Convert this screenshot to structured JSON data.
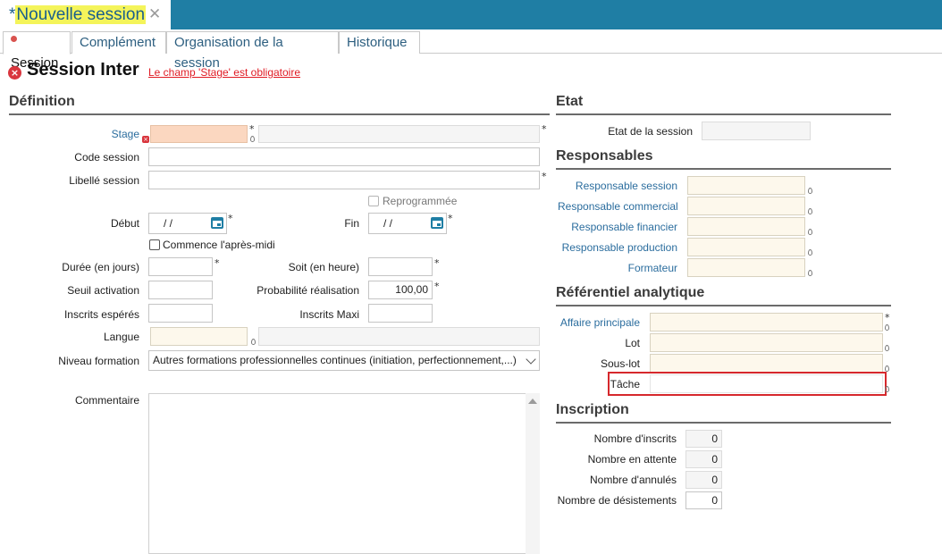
{
  "tab": {
    "modified_marker": "*",
    "title": "Nouvelle session",
    "close_glyph": "✕"
  },
  "subtabs": [
    "Session",
    "Complément",
    "Organisation de la session",
    "Historique"
  ],
  "page": {
    "title": "Session Inter",
    "error_message": "Le champ 'Stage' est obligatoire"
  },
  "definition": {
    "header": "Définition",
    "stage_label": "Stage",
    "code_label": "Code session",
    "libelle_label": "Libellé session",
    "reprogrammee_label": "Reprogrammée",
    "debut_label": "Début",
    "debut_value": "/  /",
    "fin_label": "Fin",
    "fin_value": "/  /",
    "apres_midi_label": "Commence l'après-midi",
    "duree_label": "Durée (en jours)",
    "soit_label": "Soit (en heure)",
    "seuil_label": "Seuil activation",
    "proba_label": "Probabilité réalisation",
    "proba_value": "100,00",
    "inscrits_esperes_label": "Inscrits espérés",
    "inscrits_maxi_label": "Inscrits Maxi",
    "langue_label": "Langue",
    "niveau_label": "Niveau formation",
    "niveau_value": "Autres formations professionnelles continues (initiation, perfectionnement,...)",
    "commentaire_label": "Commentaire",
    "required_mark": "*"
  },
  "etat": {
    "header": "Etat",
    "etat_label": "Etat de la session"
  },
  "responsables": {
    "header": "Responsables",
    "items": [
      "Responsable session",
      "Responsable commercial",
      "Responsable financier",
      "Responsable production",
      "Formateur"
    ]
  },
  "analytique": {
    "header": "Référentiel analytique",
    "affaire_label": "Affaire principale",
    "lot_label": "Lot",
    "souslot_label": "Sous-lot",
    "tache_label": "Tâche"
  },
  "inscription": {
    "header": "Inscription",
    "rows": [
      {
        "label": "Nombre d'inscrits",
        "value": "0"
      },
      {
        "label": "Nombre en attente",
        "value": "0"
      },
      {
        "label": "Nombre d'annulés",
        "value": "0"
      },
      {
        "label": "Nombre de désistements",
        "value": "0"
      }
    ]
  },
  "colors": {
    "header_bar": "#1f7ea4",
    "link": "#2b6d9e",
    "error": "#e01b24",
    "lookup_bg": "#fdf8ec",
    "error_field_bg": "#fbd7c0"
  }
}
